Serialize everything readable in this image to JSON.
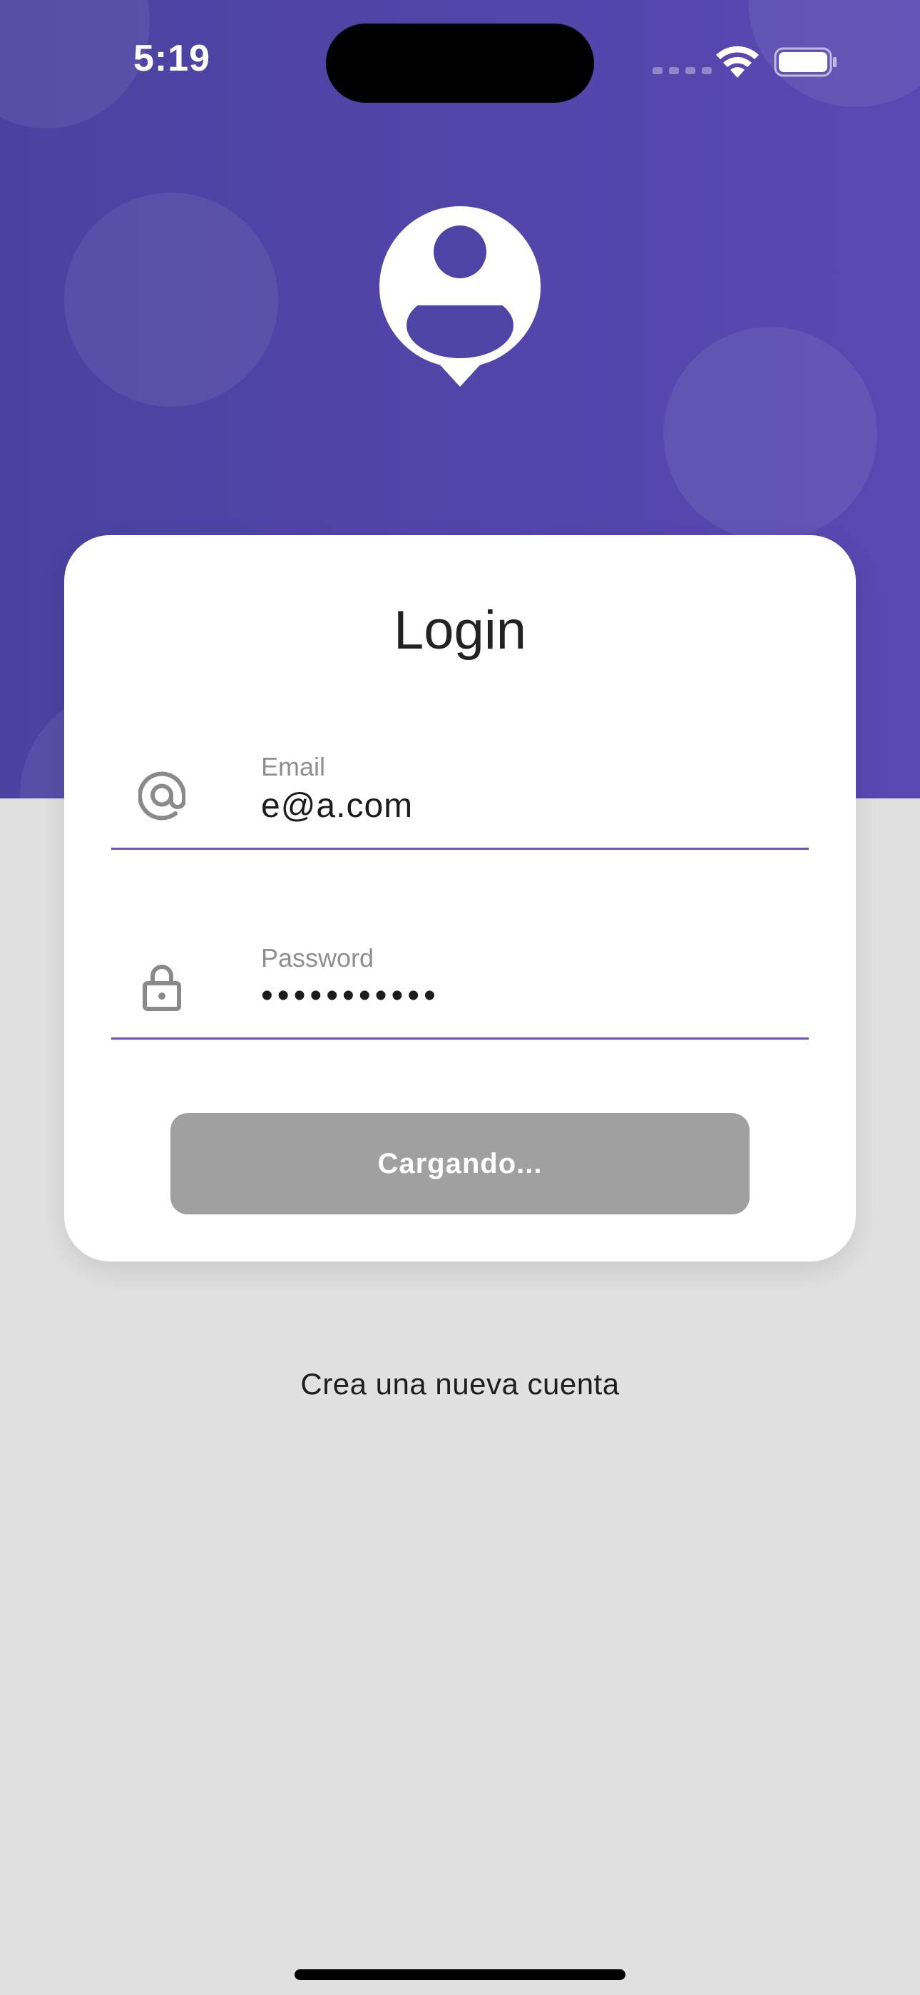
{
  "status_bar": {
    "time": "5:19",
    "icons": [
      "cellular-signal-icon",
      "wifi-icon",
      "battery-icon"
    ]
  },
  "header": {
    "logo_icon": "user-location-pin-icon",
    "background_gradient": [
      "#4a42a0",
      "#5a48b2"
    ]
  },
  "login_card": {
    "title": "Login",
    "email": {
      "label": "Email",
      "value": "e@a.com",
      "icon": "at-sign-icon"
    },
    "password": {
      "label": "Password",
      "value": "•••••••••••",
      "icon": "lock-icon"
    },
    "submit_label": "Cargando...",
    "accent_color": "#6e52b6",
    "button_color": "#a0a0a0"
  },
  "footer": {
    "create_account_label": "Crea una nueva cuenta"
  }
}
